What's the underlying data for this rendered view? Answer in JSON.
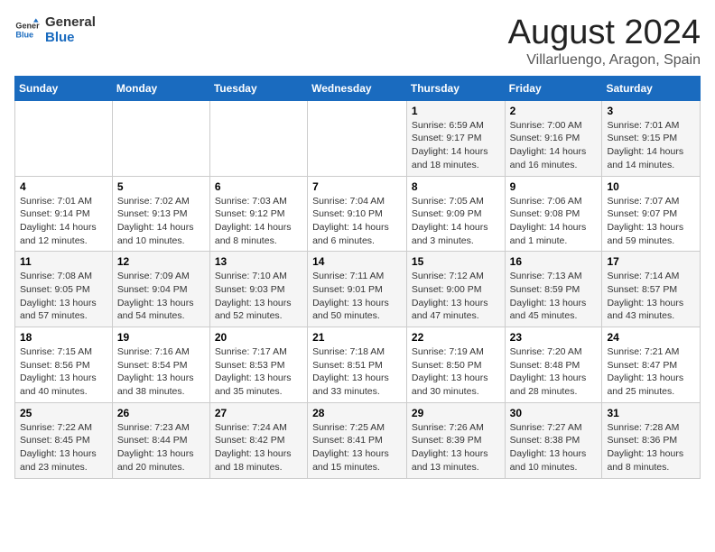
{
  "logo": {
    "text_general": "General",
    "text_blue": "Blue"
  },
  "header": {
    "month_year": "August 2024",
    "location": "Villarluengo, Aragon, Spain"
  },
  "weekdays": [
    "Sunday",
    "Monday",
    "Tuesday",
    "Wednesday",
    "Thursday",
    "Friday",
    "Saturday"
  ],
  "weeks": [
    [
      {
        "day": "",
        "info": ""
      },
      {
        "day": "",
        "info": ""
      },
      {
        "day": "",
        "info": ""
      },
      {
        "day": "",
        "info": ""
      },
      {
        "day": "1",
        "info": "Sunrise: 6:59 AM\nSunset: 9:17 PM\nDaylight: 14 hours\nand 18 minutes."
      },
      {
        "day": "2",
        "info": "Sunrise: 7:00 AM\nSunset: 9:16 PM\nDaylight: 14 hours\nand 16 minutes."
      },
      {
        "day": "3",
        "info": "Sunrise: 7:01 AM\nSunset: 9:15 PM\nDaylight: 14 hours\nand 14 minutes."
      }
    ],
    [
      {
        "day": "4",
        "info": "Sunrise: 7:01 AM\nSunset: 9:14 PM\nDaylight: 14 hours\nand 12 minutes."
      },
      {
        "day": "5",
        "info": "Sunrise: 7:02 AM\nSunset: 9:13 PM\nDaylight: 14 hours\nand 10 minutes."
      },
      {
        "day": "6",
        "info": "Sunrise: 7:03 AM\nSunset: 9:12 PM\nDaylight: 14 hours\nand 8 minutes."
      },
      {
        "day": "7",
        "info": "Sunrise: 7:04 AM\nSunset: 9:10 PM\nDaylight: 14 hours\nand 6 minutes."
      },
      {
        "day": "8",
        "info": "Sunrise: 7:05 AM\nSunset: 9:09 PM\nDaylight: 14 hours\nand 3 minutes."
      },
      {
        "day": "9",
        "info": "Sunrise: 7:06 AM\nSunset: 9:08 PM\nDaylight: 14 hours\nand 1 minute."
      },
      {
        "day": "10",
        "info": "Sunrise: 7:07 AM\nSunset: 9:07 PM\nDaylight: 13 hours\nand 59 minutes."
      }
    ],
    [
      {
        "day": "11",
        "info": "Sunrise: 7:08 AM\nSunset: 9:05 PM\nDaylight: 13 hours\nand 57 minutes."
      },
      {
        "day": "12",
        "info": "Sunrise: 7:09 AM\nSunset: 9:04 PM\nDaylight: 13 hours\nand 54 minutes."
      },
      {
        "day": "13",
        "info": "Sunrise: 7:10 AM\nSunset: 9:03 PM\nDaylight: 13 hours\nand 52 minutes."
      },
      {
        "day": "14",
        "info": "Sunrise: 7:11 AM\nSunset: 9:01 PM\nDaylight: 13 hours\nand 50 minutes."
      },
      {
        "day": "15",
        "info": "Sunrise: 7:12 AM\nSunset: 9:00 PM\nDaylight: 13 hours\nand 47 minutes."
      },
      {
        "day": "16",
        "info": "Sunrise: 7:13 AM\nSunset: 8:59 PM\nDaylight: 13 hours\nand 45 minutes."
      },
      {
        "day": "17",
        "info": "Sunrise: 7:14 AM\nSunset: 8:57 PM\nDaylight: 13 hours\nand 43 minutes."
      }
    ],
    [
      {
        "day": "18",
        "info": "Sunrise: 7:15 AM\nSunset: 8:56 PM\nDaylight: 13 hours\nand 40 minutes."
      },
      {
        "day": "19",
        "info": "Sunrise: 7:16 AM\nSunset: 8:54 PM\nDaylight: 13 hours\nand 38 minutes."
      },
      {
        "day": "20",
        "info": "Sunrise: 7:17 AM\nSunset: 8:53 PM\nDaylight: 13 hours\nand 35 minutes."
      },
      {
        "day": "21",
        "info": "Sunrise: 7:18 AM\nSunset: 8:51 PM\nDaylight: 13 hours\nand 33 minutes."
      },
      {
        "day": "22",
        "info": "Sunrise: 7:19 AM\nSunset: 8:50 PM\nDaylight: 13 hours\nand 30 minutes."
      },
      {
        "day": "23",
        "info": "Sunrise: 7:20 AM\nSunset: 8:48 PM\nDaylight: 13 hours\nand 28 minutes."
      },
      {
        "day": "24",
        "info": "Sunrise: 7:21 AM\nSunset: 8:47 PM\nDaylight: 13 hours\nand 25 minutes."
      }
    ],
    [
      {
        "day": "25",
        "info": "Sunrise: 7:22 AM\nSunset: 8:45 PM\nDaylight: 13 hours\nand 23 minutes."
      },
      {
        "day": "26",
        "info": "Sunrise: 7:23 AM\nSunset: 8:44 PM\nDaylight: 13 hours\nand 20 minutes."
      },
      {
        "day": "27",
        "info": "Sunrise: 7:24 AM\nSunset: 8:42 PM\nDaylight: 13 hours\nand 18 minutes."
      },
      {
        "day": "28",
        "info": "Sunrise: 7:25 AM\nSunset: 8:41 PM\nDaylight: 13 hours\nand 15 minutes."
      },
      {
        "day": "29",
        "info": "Sunrise: 7:26 AM\nSunset: 8:39 PM\nDaylight: 13 hours\nand 13 minutes."
      },
      {
        "day": "30",
        "info": "Sunrise: 7:27 AM\nSunset: 8:38 PM\nDaylight: 13 hours\nand 10 minutes."
      },
      {
        "day": "31",
        "info": "Sunrise: 7:28 AM\nSunset: 8:36 PM\nDaylight: 13 hours\nand 8 minutes."
      }
    ]
  ]
}
